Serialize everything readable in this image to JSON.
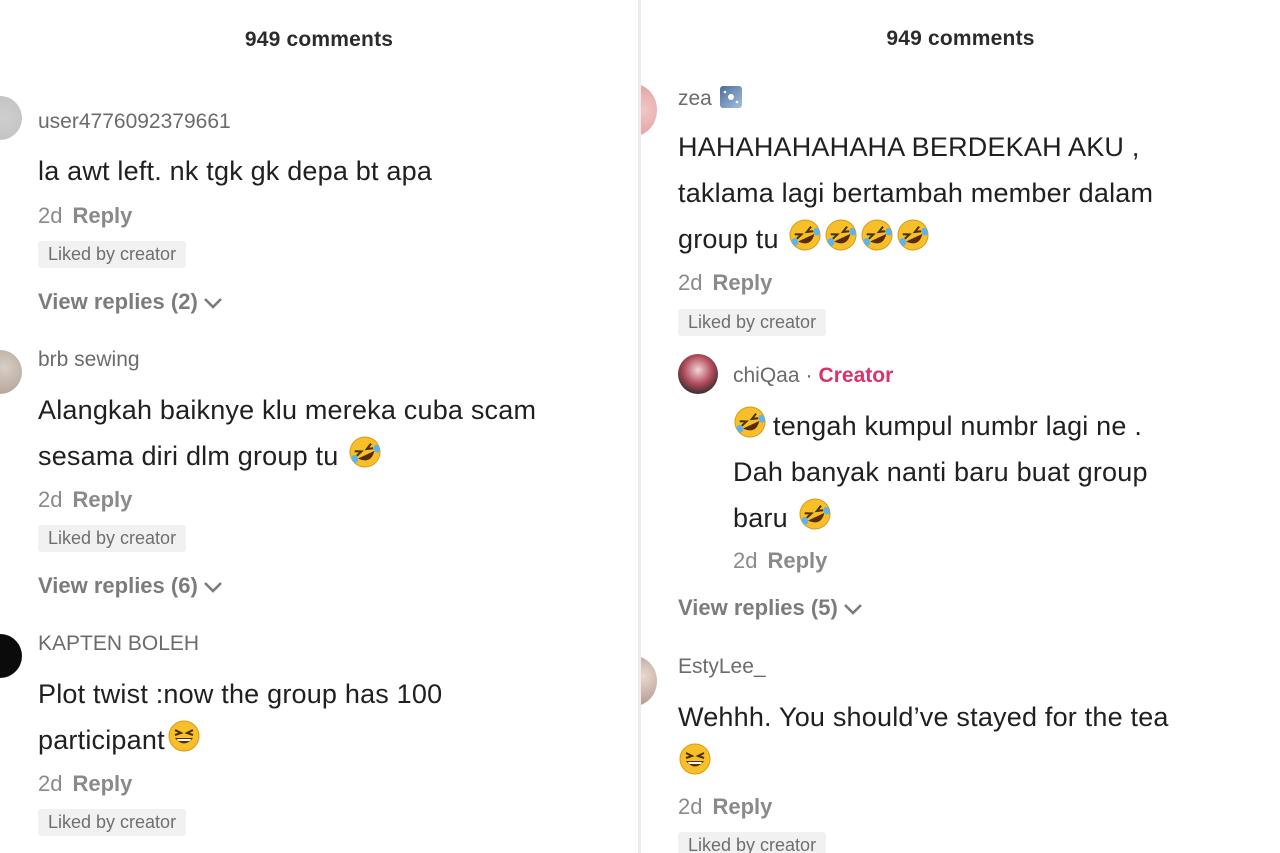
{
  "left": {
    "header": "949 comments",
    "comments": [
      {
        "username": "user4776092379661",
        "lines": [
          "la awt left. nk tgk gk depa bt apa"
        ],
        "time": "2d",
        "reply_label": "Reply",
        "liked": "Liked by creator",
        "view_replies": "View replies (2)"
      },
      {
        "username": "brb sewing",
        "lines": [
          "Alangkah baiknye klu mereka cuba scam",
          "sesama diri dlm group tu"
        ],
        "time": "2d",
        "reply_label": "Reply",
        "liked": "Liked by creator",
        "view_replies": "View replies (6)"
      },
      {
        "username": "KAPTEN BOLEH",
        "lines": [
          "Plot twist :now the group has 100",
          "participant"
        ],
        "time": "2d",
        "reply_label": "Reply",
        "liked": "Liked by creator"
      }
    ]
  },
  "right": {
    "header": "949 comments",
    "comments": [
      {
        "username": "zea",
        "lines": [
          "HAHAHAHAHAHA BERDEKAH AKU ,",
          "taklama lagi bertambah member dalam",
          "group tu"
        ],
        "time": "2d",
        "reply_label": "Reply",
        "liked": "Liked by creator"
      },
      {
        "username": "chiQaa",
        "creator_tag": "Creator",
        "dot": "·",
        "lines": [
          "tengah kumpul numbr lagi ne .",
          "Dah banyak nanti baru buat group",
          "baru"
        ],
        "time": "2d",
        "reply_label": "Reply"
      },
      {
        "view_replies": "View replies (5)"
      },
      {
        "username": "EstyLee_",
        "lines": [
          "Wehhh. You should’ve stayed for the tea"
        ],
        "time": "2d",
        "reply_label": "Reply",
        "liked": "Liked by creator"
      }
    ]
  },
  "emoji": {
    "rofl": "rolling-on-floor-laughing-emoji",
    "joy": "grinning-squinting-face-emoji",
    "sparkle": "night-sky-sparkle-icon"
  },
  "colors": {
    "creator_tag": "#d9336a",
    "liked_bg": "#f1f1f2"
  }
}
